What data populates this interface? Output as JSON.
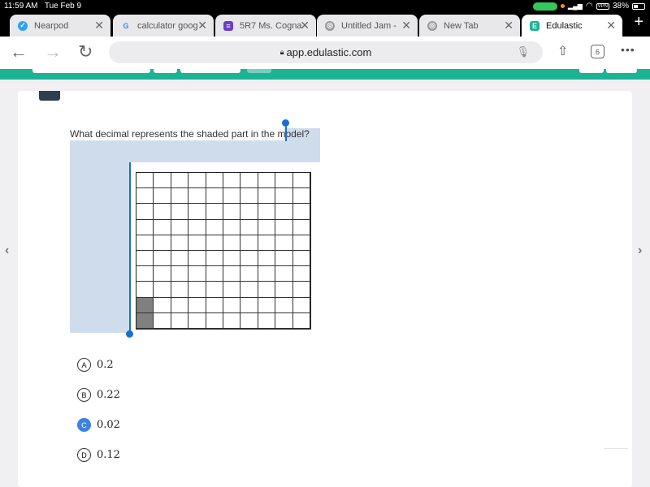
{
  "status_bar": {
    "time": "11:59 AM",
    "date": "Tue Feb 9",
    "battery": "38%",
    "vpn": "VPN"
  },
  "tabs": [
    {
      "label": "Nearpod",
      "icon": "nearpod-icon",
      "color": "#2aa3f5",
      "active": false
    },
    {
      "label": "calculator goog",
      "icon": "google-icon",
      "color": "#ffffff",
      "active": false
    },
    {
      "label": "5R7 Ms. Cogna",
      "icon": "classroom-icon",
      "color": "#6a3fc7",
      "active": false
    },
    {
      "label": "Untitled Jam - ",
      "icon": "globe-icon",
      "color": "#999999",
      "active": false
    },
    {
      "label": "New Tab",
      "icon": "globe-icon",
      "color": "#999999",
      "active": false
    },
    {
      "label": "Edulastic",
      "icon": "edulastic-icon",
      "color": "#1ab394",
      "active": true
    }
  ],
  "toolbar": {
    "url": "app.edulastic.com",
    "tab_count": "6"
  },
  "question": {
    "text": "What decimal represents the shaded part in the model?"
  },
  "model": {
    "rows": 10,
    "cols": 10,
    "shaded_cells": 2,
    "shaded_color": "#808080"
  },
  "options": [
    {
      "letter": "A",
      "value": "0.2",
      "selected": false
    },
    {
      "letter": "B",
      "value": "0.22",
      "selected": false
    },
    {
      "letter": "C",
      "value": "0.02",
      "selected": true
    },
    {
      "letter": "D",
      "value": "0.12",
      "selected": false
    }
  ],
  "colors": {
    "accent": "#1ab394",
    "selected": "#3c82e0",
    "selection": "#cfdcec"
  }
}
